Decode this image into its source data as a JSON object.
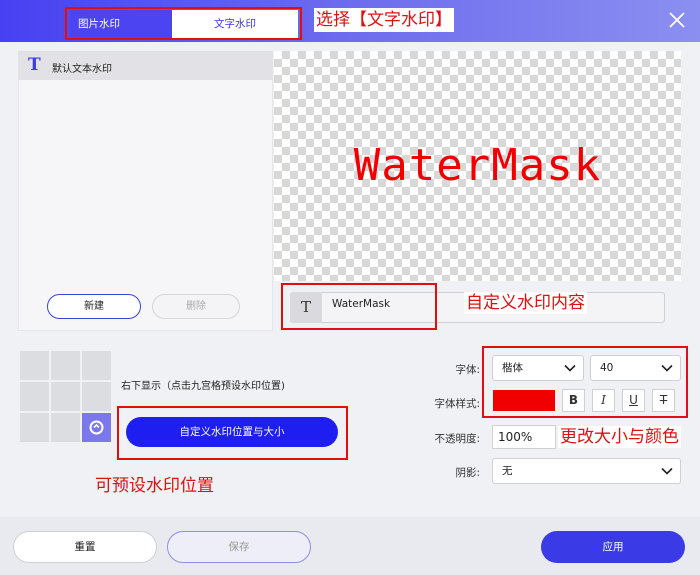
{
  "tabs": {
    "image": "图片水印",
    "text": "文字水印"
  },
  "annotations": {
    "select_tab": "选择【文字水印】",
    "custom_content": "自定义水印内容",
    "change_style": "更改大小与颜色",
    "preset_position": "可预设水印位置"
  },
  "list": {
    "item_label": "默认文本水印",
    "new_button": "新建",
    "delete_button": "删除"
  },
  "preview": {
    "text": "WaterMask",
    "text_color": "#f00000"
  },
  "content": {
    "value": "WaterMask"
  },
  "position": {
    "hint": "右下显示（点击九宫格预设水印位置)",
    "custom_button": "自定义水印位置与大小",
    "selected_cell": "bottom-right"
  },
  "font": {
    "label": "字体:",
    "family": "楷体",
    "size": "40",
    "style_label": "字体样式:",
    "color": "#f00000",
    "bold": "B",
    "italic": "I",
    "underline": "U",
    "strikethrough": "T"
  },
  "opacity": {
    "label": "不透明度:",
    "value": "100%"
  },
  "shadow": {
    "label": "阴影:",
    "value": "无"
  },
  "footer": {
    "reset": "重置",
    "save": "保存",
    "apply": "应用"
  },
  "colors": {
    "accent": "#1e1ef0",
    "annotation": "#e01010"
  }
}
